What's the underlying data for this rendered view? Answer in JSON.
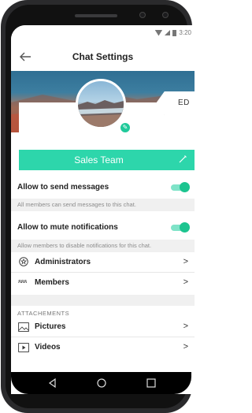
{
  "status": {
    "time": "3:20"
  },
  "header": {
    "title": "Chat Settings"
  },
  "edit_callout": "ED",
  "team": {
    "name": "Sales Team"
  },
  "settings": [
    {
      "label": "Allow to send messages",
      "hint": "All members can send messages to this chat.",
      "on": true
    },
    {
      "label": "Allow to mute notifications",
      "hint": "Allow members to disable notifications for this chat.",
      "on": true
    }
  ],
  "roles": [
    {
      "label": "Administrators",
      "icon": "star-badge-icon"
    },
    {
      "label": "Members",
      "icon": "members-icon"
    }
  ],
  "attachments": {
    "section_title": "ATTACHEMENTS",
    "items": [
      {
        "label": "Pictures",
        "icon": "picture-icon"
      },
      {
        "label": "Videos",
        "icon": "video-icon"
      }
    ]
  },
  "colors": {
    "accent": "#2dd6ab",
    "toggle": "#1cc48f"
  }
}
